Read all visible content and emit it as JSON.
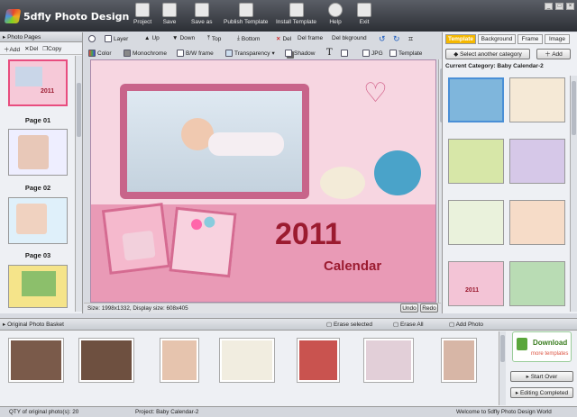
{
  "app": {
    "title": "5dfly Photo Design"
  },
  "toolbar": [
    {
      "label": "Project",
      "icon": "project-icon"
    },
    {
      "label": "Save",
      "icon": "save-icon"
    },
    {
      "label": "Save as",
      "icon": "save-as-icon"
    },
    {
      "label": "Publish Template",
      "icon": "publish-template-icon"
    },
    {
      "label": "Install Template",
      "icon": "install-template-icon"
    },
    {
      "label": "Help",
      "icon": "help-icon"
    },
    {
      "label": "Exit",
      "icon": "exit-icon"
    }
  ],
  "left": {
    "header": "Photo Pages",
    "add": "Add",
    "del": "Del",
    "copy": "Copy",
    "pages": [
      "Page 01",
      "Page 02",
      "Page 03"
    ]
  },
  "edit_toolbar": {
    "layer": "Layer",
    "up": "Up",
    "down": "Down",
    "top": "Top",
    "bottom": "Bottom",
    "del": "Del",
    "del_frame": "Del frame",
    "del_background": "Del bkground",
    "color": "Color",
    "monochrome": "Monochrome",
    "bw_frame": "B/W frame",
    "transparency": "Transparency",
    "shadow": "Shadow",
    "jpg": "JPG",
    "template": "Template"
  },
  "canvas": {
    "year": "2011",
    "calendar": "Calendar"
  },
  "center_status": {
    "size": "Size: 1998x1332, Display size: 608x405",
    "undo": "Undo",
    "redo": "Redo"
  },
  "right": {
    "tabs": [
      "Template",
      "Background",
      "Frame",
      "Image"
    ],
    "select_category": "Select another category",
    "add": "Add",
    "current_category": "Current Category: Baby Calendar-2"
  },
  "bottom": {
    "header": "Original Photo Basket",
    "erase_selected": "Erase selected",
    "erase_all": "Erase All",
    "add_photo": "Add Photo",
    "download_title": "Download",
    "download_sub": "more templates",
    "start_over": "Start Over",
    "editing_completed": "Editing Completed"
  },
  "footer": {
    "qty": "QTY of original photo(s): 20",
    "project": "Project: Baby Calendar-2",
    "welcome": "Welcome to 5dfly Photo Design World"
  },
  "colors": {
    "accent": "#f5b800",
    "title": "#9b1b30",
    "pink": "#f7d6e1"
  }
}
